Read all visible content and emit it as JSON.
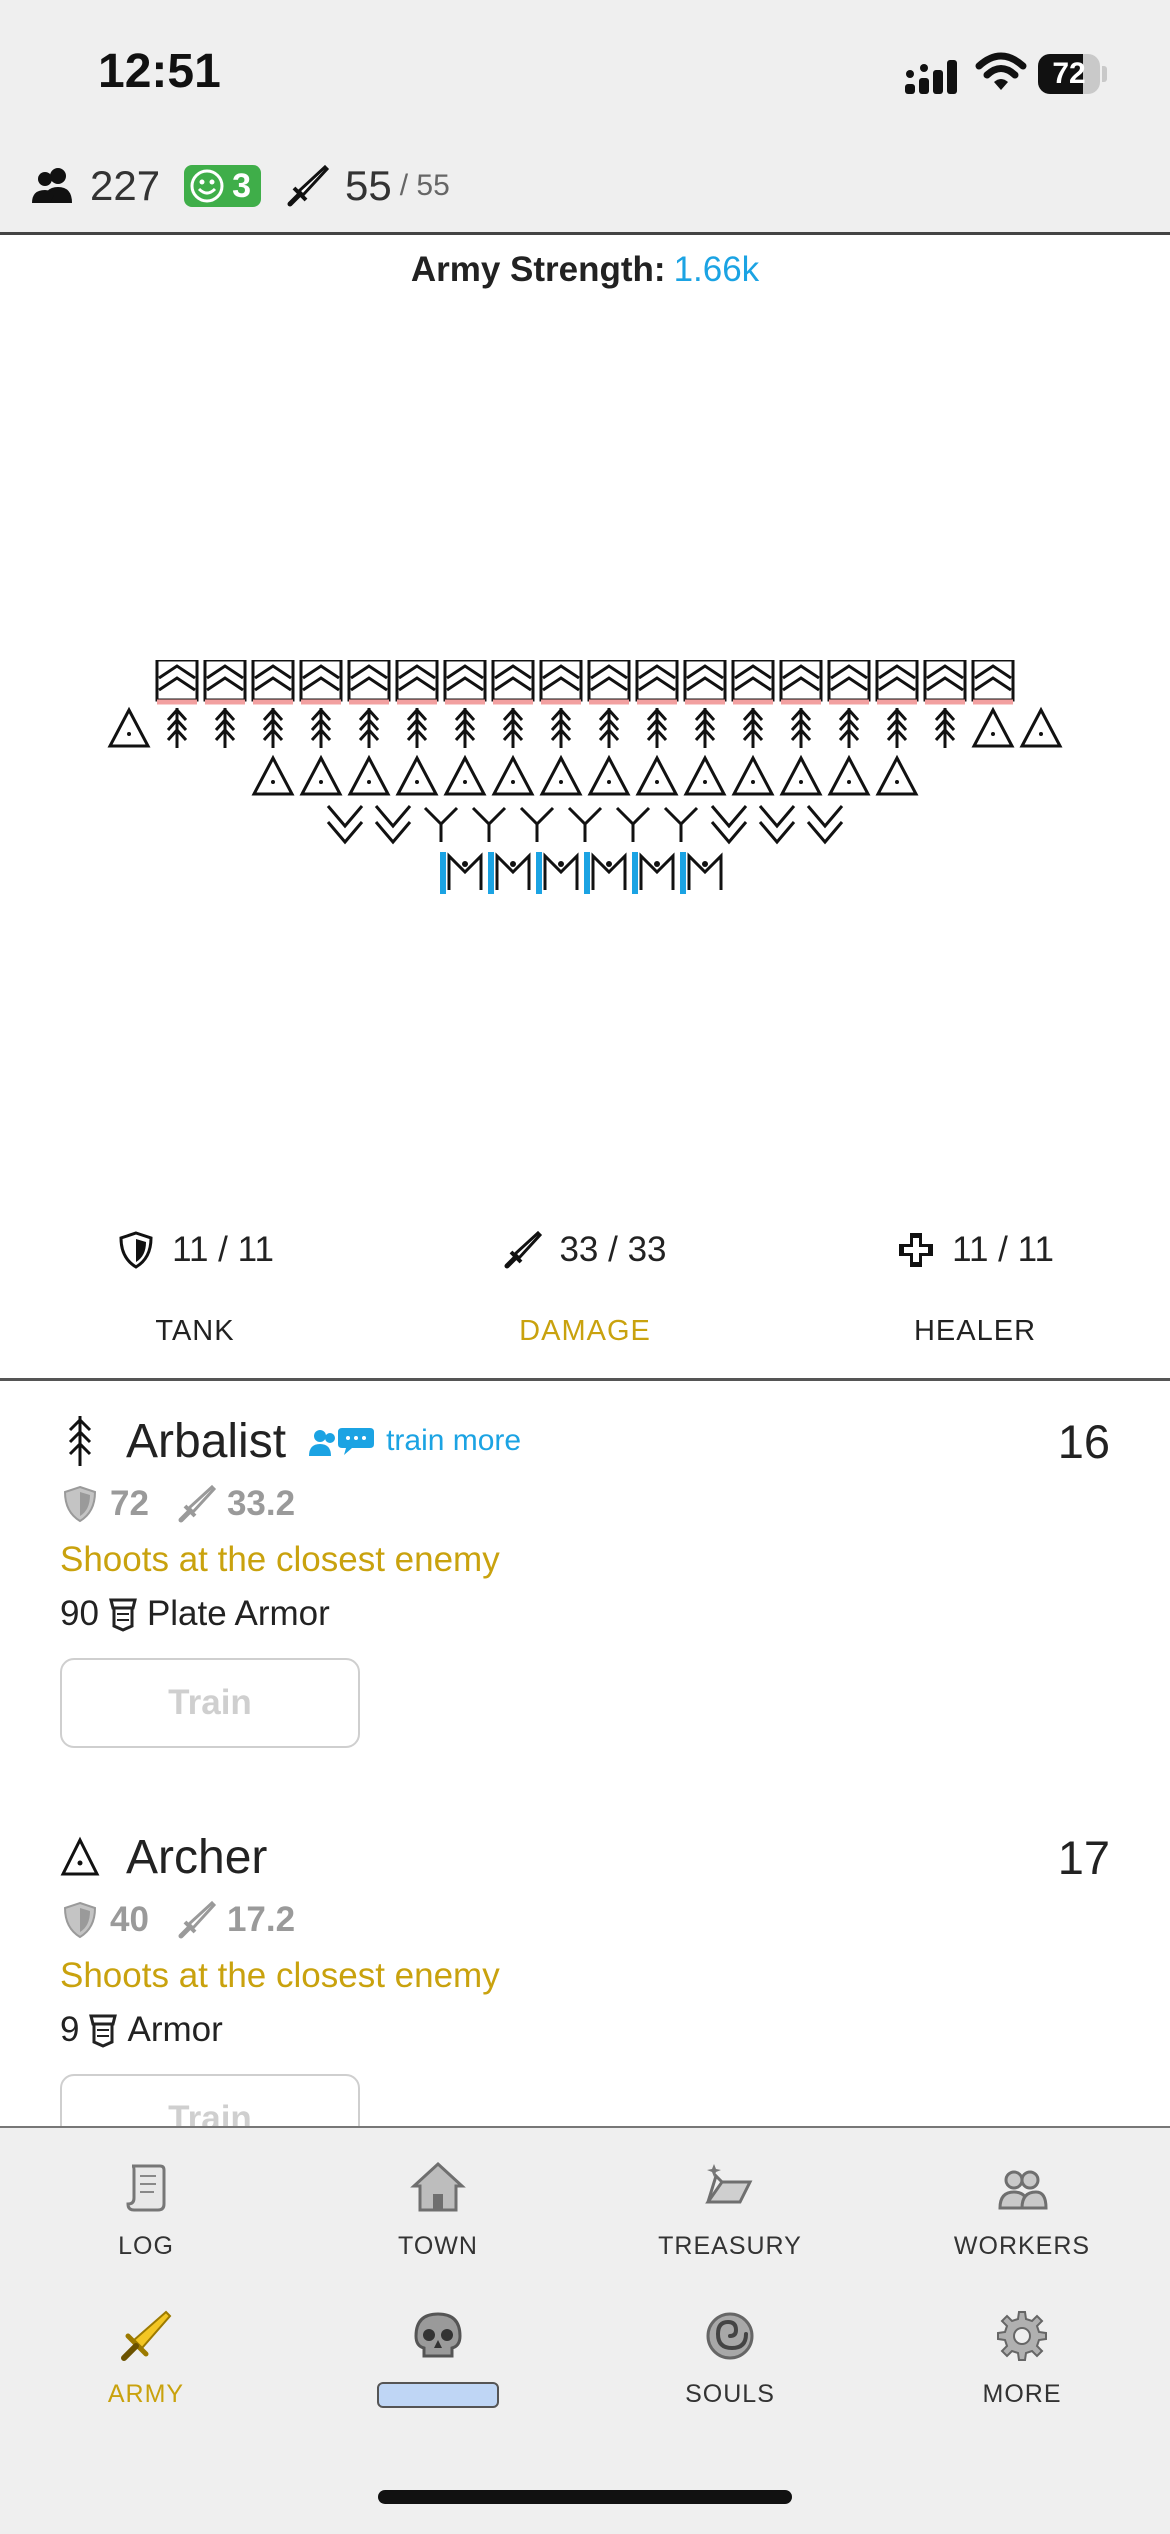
{
  "status_bar": {
    "time": "12:51",
    "battery": "72",
    "battery_level": 0.72
  },
  "resources": {
    "population": "227",
    "happiness": "3",
    "soldiers": "55",
    "soldiers_max": "/ 55"
  },
  "army": {
    "strength_label": "Army Strength:",
    "strength_value": "1.66k"
  },
  "formation": {
    "rows": [
      [
        "W",
        "W",
        "W",
        "W",
        "W",
        "W",
        "W",
        "W",
        "W",
        "W",
        "W",
        "W",
        "W",
        "W",
        "W",
        "W",
        "W",
        "W"
      ],
      [
        "A",
        "R",
        "R",
        "R",
        "R",
        "R",
        "R",
        "R",
        "R",
        "R",
        "R",
        "R",
        "R",
        "R",
        "R",
        "R",
        "R",
        "R",
        "A",
        "A"
      ],
      [
        "A",
        "A",
        "A",
        "A",
        "A",
        "A",
        "A",
        "A",
        "A",
        "A",
        "A",
        "A",
        "A",
        "A"
      ],
      [
        "V",
        "V",
        "Y",
        "Y",
        "Y",
        "Y",
        "Y",
        "Y",
        "V",
        "V",
        "V"
      ],
      [
        "M",
        "M",
        "M",
        "M",
        "M",
        "M"
      ]
    ]
  },
  "roles": [
    {
      "icon": "shield-icon",
      "count": "11 / 11",
      "name": "TANK",
      "active": false
    },
    {
      "icon": "sword-icon",
      "count": "33 / 33",
      "name": "DAMAGE",
      "active": true
    },
    {
      "icon": "cross-icon",
      "count": "11 / 11",
      "name": "HEALER",
      "active": false
    }
  ],
  "units": [
    {
      "name": "Arbalist",
      "icon": "arbalist-icon",
      "count": "16",
      "train_more": "train more",
      "armor": "72",
      "damage": "33.2",
      "description": "Shoots at the closest enemy",
      "cost_amount": "90",
      "cost_item": "Plate Armor",
      "button": "Train"
    },
    {
      "name": "Archer",
      "icon": "archer-icon",
      "count": "17",
      "train_more": "",
      "armor": "40",
      "damage": "17.2",
      "description": "Shoots at the closest enemy",
      "cost_amount": "9",
      "cost_item": "Armor",
      "button": "Train"
    }
  ],
  "nav": {
    "row1": [
      {
        "label": "LOG",
        "icon": "scroll-icon"
      },
      {
        "label": "TOWN",
        "icon": "house-icon"
      },
      {
        "label": "TREASURY",
        "icon": "ingot-icon"
      },
      {
        "label": "WORKERS",
        "icon": "workers-icon"
      }
    ],
    "row2": [
      {
        "label": "ARMY",
        "icon": "sword-icon",
        "active": true
      },
      {
        "label": "",
        "icon": "skull-icon"
      },
      {
        "label": "SOULS",
        "icon": "spiral-icon"
      },
      {
        "label": "MORE",
        "icon": "gear-icon"
      }
    ]
  },
  "colors": {
    "accent_gold": "#c9a20e",
    "link_blue": "#1ba3e3",
    "happy_green": "#3fae49"
  }
}
